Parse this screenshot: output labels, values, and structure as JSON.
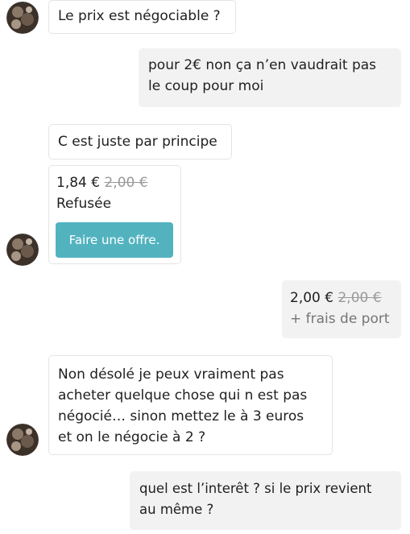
{
  "conversation": {
    "messages": [
      {
        "text": "Le prix est négociable ?"
      },
      {
        "text_line1": "pour 2€ non ça n’en vaudrait pas",
        "text_line2": "le coup pour moi"
      },
      {
        "text": "C est juste par principe"
      },
      {
        "offer_price": "1,84 €",
        "original_price": "2,00 €",
        "status": "Refusée",
        "button_label": "Faire une offre."
      },
      {
        "offer_price": "2,00 €",
        "original_price": "2,00 €",
        "note": "+ frais de port"
      },
      {
        "line1": "Non désolé je peux vraiment pas",
        "line2": "acheter quelque chose qui n est pas",
        "line3": "négocié… sinon mettez le à 3 euros",
        "line4": "et on le négocie à 2 ?"
      },
      {
        "line1": "quel est l’interêt ? si le prix revient",
        "line2": "au même ?"
      }
    ]
  },
  "icons": {
    "avatar": "user-avatar-icon"
  },
  "colors": {
    "accent": "#52b3bf",
    "incoming_bubble_bg": "#ffffff",
    "outgoing_bubble_bg": "#f2f2f2",
    "muted_text": "#9a9a9a"
  }
}
